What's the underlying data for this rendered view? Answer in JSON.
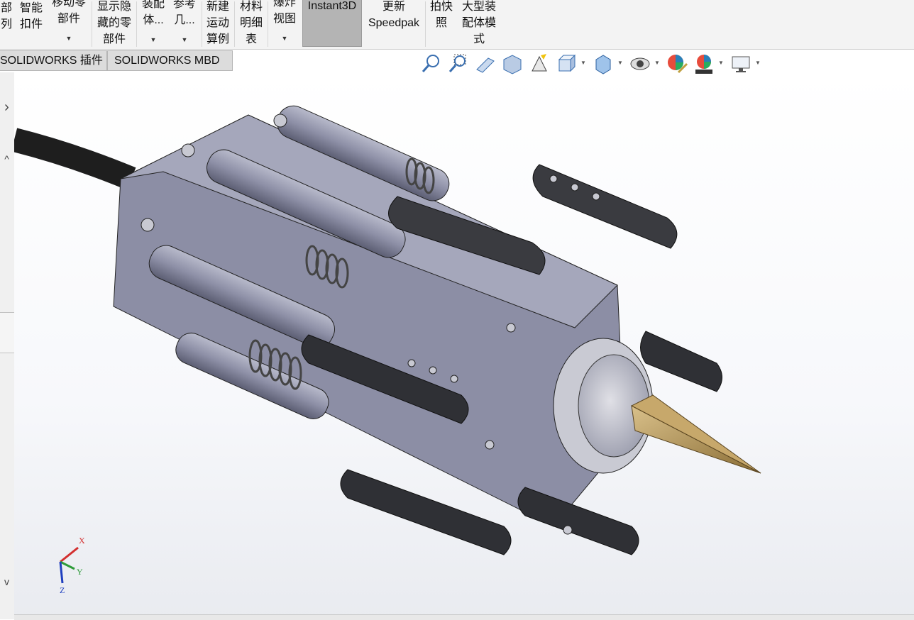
{
  "ribbon": {
    "items": [
      {
        "lines": [
          "部",
          "列"
        ],
        "arrow": false
      },
      {
        "lines": [
          "智能",
          "扣件"
        ],
        "arrow": false
      },
      {
        "lines": [
          "移动零",
          "部件"
        ],
        "arrow": true
      },
      {
        "lines": [
          "显示隐",
          "藏的零",
          "部件"
        ],
        "arrow": false
      },
      {
        "lines": [
          "装配",
          "体..."
        ],
        "arrow": true
      },
      {
        "lines": [
          "参考",
          "几..."
        ],
        "arrow": true
      },
      {
        "lines": [
          "新建",
          "运动",
          "算例"
        ],
        "arrow": false
      },
      {
        "lines": [
          "材料",
          "明细",
          "表"
        ],
        "arrow": false
      },
      {
        "lines": [
          "爆炸",
          "视图"
        ],
        "arrow": true
      },
      {
        "lines": [
          "Instant3D"
        ],
        "arrow": false
      },
      {
        "lines": [
          "更新",
          "Speedpak"
        ],
        "arrow": false
      },
      {
        "lines": [
          "拍快",
          "照"
        ],
        "arrow": false
      },
      {
        "lines": [
          "大型装",
          "配体模",
          "式"
        ],
        "arrow": false
      }
    ]
  },
  "tabs": [
    {
      "label": "SOLIDWORKS 插件"
    },
    {
      "label": "SOLIDWORKS MBD"
    }
  ],
  "headsup": {
    "icons": [
      "zoom-to-fit-icon",
      "zoom-to-area-icon",
      "previous-view-icon",
      "section-view-icon",
      "dynamic-annotation-icon",
      "view-orientation-icon",
      "display-style-icon",
      "hide-show-items-icon",
      "edit-appearance-icon",
      "apply-scene-icon",
      "view-settings-icon"
    ]
  },
  "triad": {
    "x": "X",
    "y": "Y",
    "z": "Z"
  },
  "colors": {
    "body": "#8d8fa6",
    "dark": "#2e2f33",
    "cable": "#222222",
    "drill": "#b89a5c",
    "axis_x": "#d32f2f",
    "axis_y": "#2e9b3a",
    "axis_z": "#1f3fbf",
    "active_button": "#b4b4b4"
  }
}
